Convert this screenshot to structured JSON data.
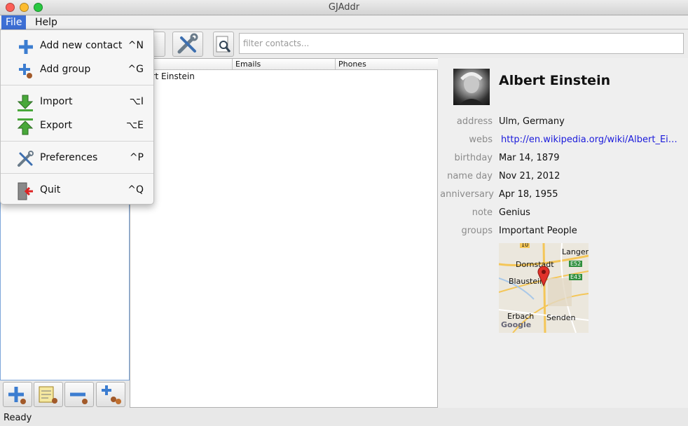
{
  "window": {
    "title": "GJAddr"
  },
  "menubar": {
    "file": "File",
    "help": "Help"
  },
  "file_menu": {
    "items": [
      {
        "label": "Add new contact",
        "shortcut": "^N"
      },
      {
        "label": "Add group",
        "shortcut": "^G"
      },
      {
        "label": "Import",
        "shortcut": "⌥I"
      },
      {
        "label": "Export",
        "shortcut": "⌥E"
      },
      {
        "label": "Preferences",
        "shortcut": "^P"
      },
      {
        "label": "Quit",
        "shortcut": "^Q"
      }
    ]
  },
  "toolbar": {
    "filter_placeholder": "filter contacts..."
  },
  "table": {
    "columns": [
      "Emails",
      "Phones"
    ],
    "rows": [
      {
        "name": "Albert Einstein",
        "emails": "",
        "phones": ""
      }
    ]
  },
  "contact": {
    "name": "Albert Einstein",
    "fields": [
      {
        "label": "address",
        "value": "Ulm, Germany"
      },
      {
        "label": "webs",
        "value": "http://en.wikipedia.org/wiki/Albert_Ei…"
      },
      {
        "label": "birthday",
        "value": "Mar 14, 1879"
      },
      {
        "label": "name day",
        "value": "Nov 21, 2012"
      },
      {
        "label": "anniversary",
        "value": "Apr 18, 1955"
      },
      {
        "label": "note",
        "value": "Genius"
      },
      {
        "label": "groups",
        "value": "Important People"
      }
    ],
    "map": {
      "places": [
        "Langer",
        "Dornstadt",
        "Blaustein",
        "Erbach",
        "Senden"
      ],
      "roads": [
        "10",
        "E52",
        "E43"
      ],
      "attribution": "Google"
    }
  },
  "status": {
    "text": "Ready"
  },
  "colors": {
    "menu_highlight": "#3d6fd5",
    "link": "#1a1adb",
    "label": "#8b8b8b"
  }
}
